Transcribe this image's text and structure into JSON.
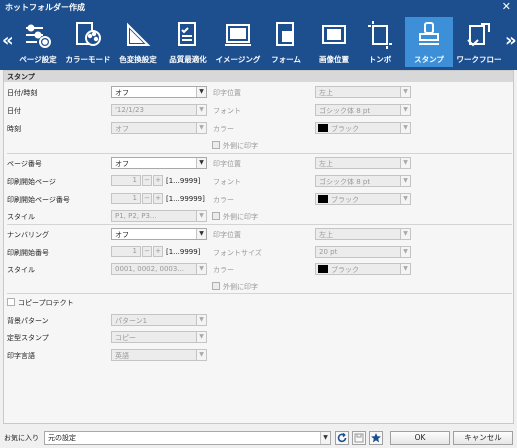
{
  "window": {
    "title": "ホットフォルダー作成"
  },
  "toolbar": {
    "prev_arrow": "«",
    "next_arrow": "»",
    "items": [
      {
        "label": "ページ設定",
        "icon": "page-settings-icon"
      },
      {
        "label": "カラーモード",
        "icon": "color-mode-icon"
      },
      {
        "label": "色変換設定",
        "icon": "color-conversion-icon"
      },
      {
        "label": "品質最適化",
        "icon": "quality-optimization-icon"
      },
      {
        "label": "イメージング",
        "icon": "imaging-icon"
      },
      {
        "label": "フォーム",
        "icon": "form-icon"
      },
      {
        "label": "画像位置",
        "icon": "image-position-icon"
      },
      {
        "label": "トンボ",
        "icon": "crop-marks-icon"
      },
      {
        "label": "スタンプ",
        "icon": "stamp-icon",
        "active": true
      },
      {
        "label": "ワークフロー",
        "icon": "workflow-icon"
      }
    ]
  },
  "stamp": {
    "section_title": "スタンプ",
    "datetime": {
      "label": "日付/時刻",
      "value": "オフ",
      "date_label": "日付",
      "date_value": "'12/1/23",
      "time_label": "時刻",
      "time_value": "オフ",
      "position_label": "印字位置",
      "position_value": "左上",
      "font_label": "フォント",
      "font_value": "ゴシック体 8 pt",
      "color_label": "カラー",
      "color_value": "ブラック",
      "outside_label": "外側に印字"
    },
    "page_number": {
      "label": "ページ番号",
      "value": "オフ",
      "start_page_label": "印刷開始ページ",
      "start_page_value": "1",
      "start_page_range": "[1...9999]",
      "start_page_num_label": "印刷開始ページ番号",
      "start_page_num_value": "1",
      "start_page_num_range": "[1...99999]",
      "style_label": "スタイル",
      "style_value": "P1, P2, P3...",
      "position_label": "印字位置",
      "position_value": "左上",
      "font_label": "フォント",
      "font_value": "ゴシック体 8 pt",
      "color_label": "カラー",
      "color_value": "ブラック",
      "outside_label": "外側に印字"
    },
    "numbering": {
      "label": "ナンバリング",
      "value": "オフ",
      "start_num_label": "印刷開始番号",
      "start_num_value": "1",
      "start_num_range": "[1...9999]",
      "style_label": "スタイル",
      "style_value": "0001, 0002, 0003...",
      "position_label": "印字位置",
      "position_value": "左上",
      "fontsize_label": "フォントサイズ",
      "fontsize_value": "20 pt",
      "color_label": "カラー",
      "color_value": "ブラック",
      "outside_label": "外側に印字"
    },
    "copy_protect": {
      "label": "コピープロテクト",
      "bg_pattern_label": "背景パターン",
      "bg_pattern_value": "パターン1",
      "fixed_stamp_label": "定型スタンプ",
      "fixed_stamp_value": "コピー",
      "lang_label": "印字言語",
      "lang_value": "英語"
    },
    "stepper": {
      "minus": "−",
      "plus": "+"
    },
    "dropdown_arrow": "▼"
  },
  "bottom": {
    "favorites_label": "お気に入り",
    "favorites_value": "元の設定",
    "ok_label": "OK",
    "cancel_label": "キャンセル"
  },
  "colors": {
    "title_bar": "#1d4f8f",
    "active_tab": "#3d8fd8"
  }
}
